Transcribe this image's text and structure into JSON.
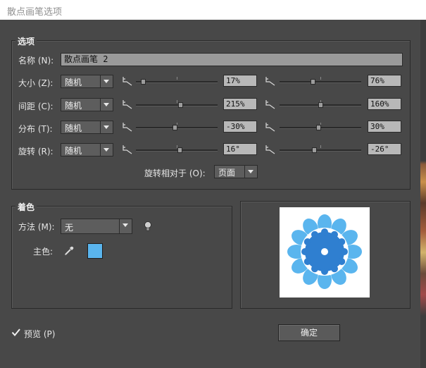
{
  "window": {
    "title": "散点画笔选项"
  },
  "options_group": {
    "title": "选项",
    "name_label": "名称 (N):",
    "name_value": "散点画笔 2",
    "rows": [
      {
        "label": "大小 (Z):",
        "mode": "随机",
        "min_value": "17%",
        "max_value": "76%",
        "min_level": 0.06,
        "max_level": 0.4
      },
      {
        "label": "间距 (C):",
        "mode": "随机",
        "min_value": "215%",
        "max_value": "160%",
        "min_level": 0.55,
        "max_level": 0.5
      },
      {
        "label": "分布 (T):",
        "mode": "随机",
        "min_value": "-30%",
        "max_value": "30%",
        "min_level": 0.48,
        "max_level": 0.48
      },
      {
        "label": "旋转 (R):",
        "mode": "随机",
        "min_value": "16°",
        "max_value": "-26°",
        "min_level": 0.54,
        "max_level": 0.42
      }
    ],
    "rotation_relative": {
      "label": "旋转相对于 (O):",
      "value": "页面"
    }
  },
  "colorization_group": {
    "title": "着色",
    "method_label": "方法 (M):",
    "method_value": "无",
    "tip_icon": "lightbulb-icon",
    "key_color_label": "主色:",
    "eyedropper_icon": "eyedropper-icon",
    "key_color": "#5ab5ee"
  },
  "preview_graphic": {
    "petal_color": "#5ab5ee",
    "center_color": "#2f7fd0",
    "dot_color": "#ffffff"
  },
  "footer": {
    "preview_label": "预览 (P)",
    "preview_checked": true,
    "ok_label": "确定"
  }
}
